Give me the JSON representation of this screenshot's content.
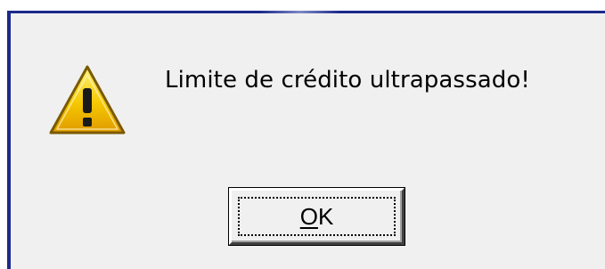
{
  "dialog": {
    "message": "Limite de crédito ultrapassado!",
    "icon": "warning-icon",
    "ok_button": {
      "mnemonic": "O",
      "rest": "K"
    }
  },
  "colors": {
    "frame": "#1c2a8a",
    "dialog_background": "#f0f0f0",
    "warning_yellow": "#f2c500"
  }
}
